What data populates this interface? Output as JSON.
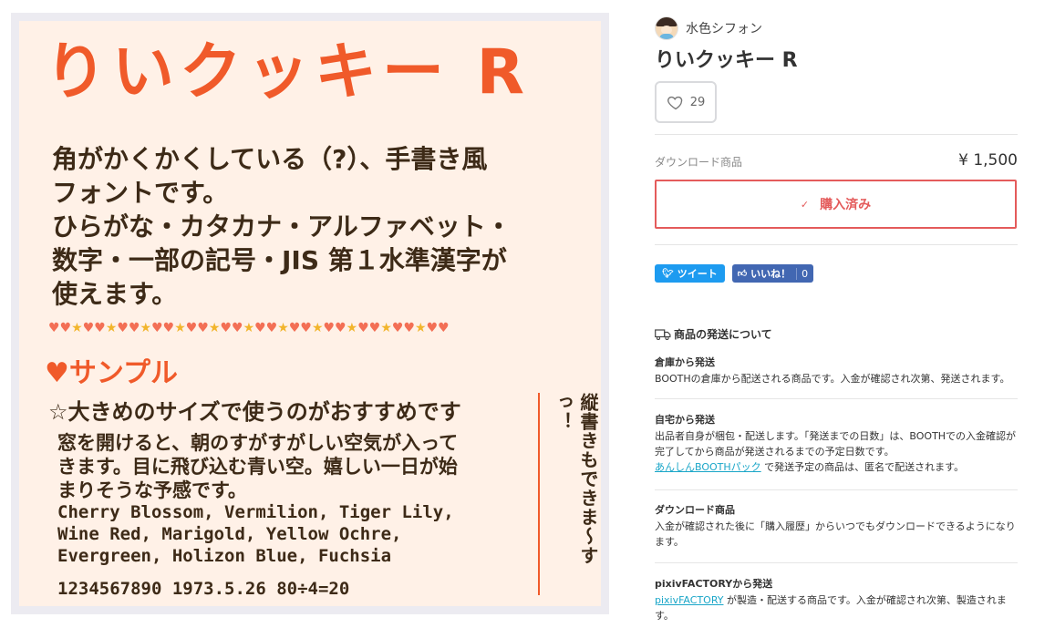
{
  "product_image": {
    "font_title": "りいクッキー R",
    "intro_lines": [
      "角がかくかくしている（?）、手書き風",
      "フォントです。",
      "ひらがな・カタカナ・アルファベット・",
      "数字・一部の記号・JIS 第１水準漢字が",
      "使えます。"
    ],
    "sample_heading": "♥サンプル",
    "sample_sub": "☆大きめのサイズで使うのがおすすめです",
    "sample_paragraph_lines": [
      "窓を開けると、朝のすがすがしい空気が入って",
      "きます。目に飛び込む青い空。嬉しい一日が始",
      "まりそうな予感です。"
    ],
    "sample_latin_lines": [
      "Cherry Blossom, Vermilion, Tiger Lily,",
      "Wine Red, Marigold, Yellow Ochre,",
      "Evergreen, Holizon Blue, Fuchsia"
    ],
    "sample_numbers": "1234567890 1973.5.26 80÷4=20",
    "vertical_text": "縦書きもできま～すっ！",
    "colors": {
      "accent": "#f05a2a",
      "text": "#3d2a17",
      "background": "#fff1e7"
    }
  },
  "shop": {
    "name": "水色シフォン",
    "avatar_icon": "shop-avatar"
  },
  "product": {
    "name": "りいクッキー R",
    "like_count": "29",
    "variant_label": "ダウンロード商品",
    "price": "¥ 1,500",
    "purchased_label": "購入済み",
    "purchased_icon": "check-icon"
  },
  "share": {
    "tweet_label": "ツイート",
    "fb_label": "いいね！",
    "fb_count": "0"
  },
  "shipping": {
    "title": "商品の発送について",
    "sections": [
      {
        "title": "倉庫から発送",
        "text": "BOOTHの倉庫から配送される商品です。入金が確認され次第、発送されます。"
      },
      {
        "title": "自宅から発送",
        "text": "出品者自身が梱包・配送します。「発送までの日数」は、BOOTHでの入金確認が完了してから商品が発送されるまでの予定日数です。",
        "link": "あんしんBOOTHパック",
        "link_suffix": " で発送予定の商品は、匿名で配送されます。"
      },
      {
        "title": "ダウンロード商品",
        "text": "入金が確認された後に「購入履歴」からいつでもダウンロードできるようになります。"
      },
      {
        "title": "pixivFACTORYから発送",
        "link": "pixivFACTORY",
        "link_suffix": " が製造・配送する商品です。入金が確認され次第、製造されます。"
      }
    ]
  }
}
